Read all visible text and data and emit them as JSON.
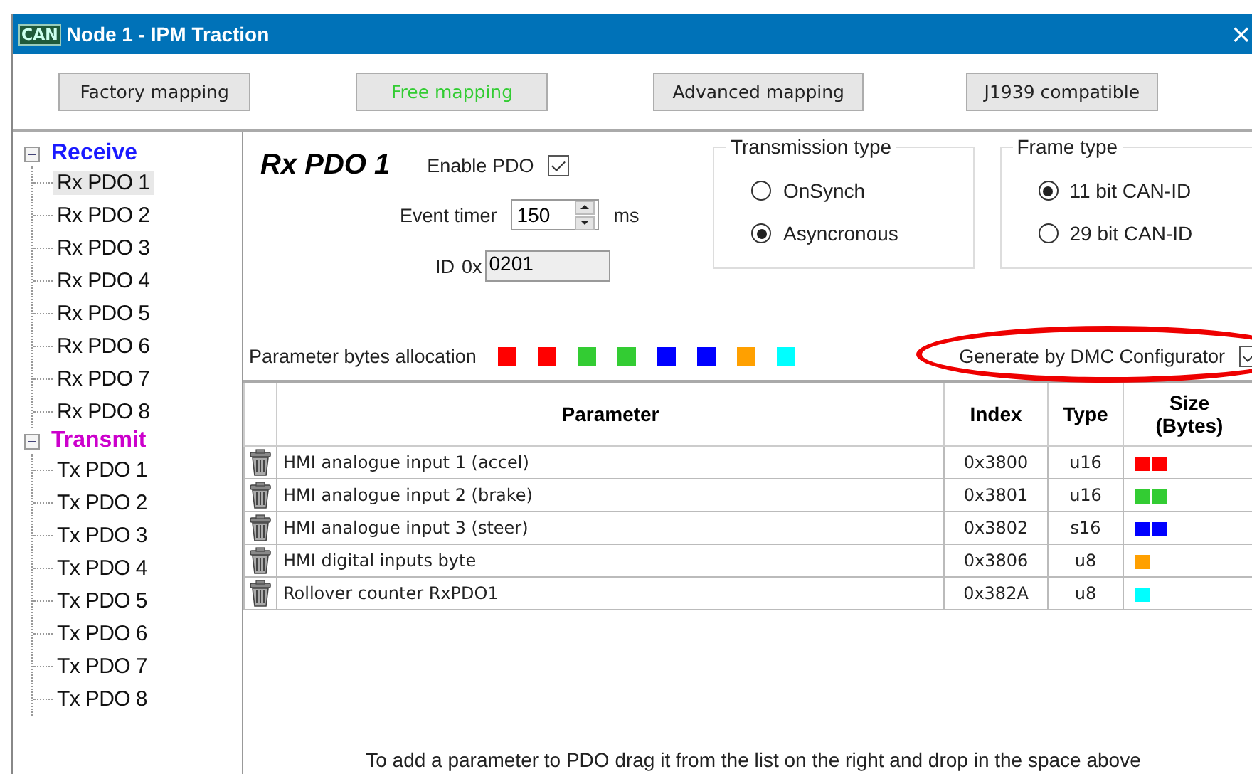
{
  "window": {
    "title": "Node 1 - IPM Traction",
    "logo": "CAN",
    "close": "×"
  },
  "mapping_buttons": [
    {
      "label": "Factory mapping",
      "selected": false
    },
    {
      "label": "Free mapping",
      "selected": true
    },
    {
      "label": "Advanced mapping",
      "selected": false
    },
    {
      "label": "J1939 compatible",
      "selected": false
    }
  ],
  "tree": [
    {
      "label": "Receive",
      "color": "#1a1aff",
      "expanded": true,
      "children": [
        {
          "label": "Rx PDO 1",
          "selected": true
        },
        {
          "label": "Rx PDO 2",
          "selected": false
        },
        {
          "label": "Rx PDO 3",
          "selected": false
        },
        {
          "label": "Rx PDO 4",
          "selected": false
        },
        {
          "label": "Rx PDO 5",
          "selected": false
        },
        {
          "label": "Rx PDO 6",
          "selected": false
        },
        {
          "label": "Rx PDO 7",
          "selected": false
        },
        {
          "label": "Rx PDO 8",
          "selected": false
        }
      ]
    },
    {
      "label": "Transmit",
      "color": "#cc00cc",
      "expanded": true,
      "children": [
        {
          "label": "Tx PDO 1",
          "selected": false
        },
        {
          "label": "Tx PDO 2",
          "selected": false
        },
        {
          "label": "Tx PDO 3",
          "selected": false
        },
        {
          "label": "Tx PDO 4",
          "selected": false
        },
        {
          "label": "Tx PDO 5",
          "selected": false
        },
        {
          "label": "Tx PDO 6",
          "selected": false
        },
        {
          "label": "Tx PDO 7",
          "selected": false
        },
        {
          "label": "Tx PDO 8",
          "selected": false
        }
      ]
    }
  ],
  "pdo": {
    "title": "Rx PDO 1",
    "enable_label": "Enable PDO",
    "enabled": true,
    "event_timer": {
      "label": "Event timer",
      "value": "150",
      "unit": "ms"
    },
    "id": {
      "label": "ID",
      "prefix": "0x",
      "value": "0201"
    },
    "transmission_type": {
      "title": "Transmission type",
      "options": [
        {
          "label": "OnSynch",
          "selected": false
        },
        {
          "label": "Asyncronous",
          "selected": true
        }
      ]
    },
    "frame_type": {
      "title": "Frame type",
      "options": [
        {
          "label": "11 bit CAN-ID",
          "selected": true
        },
        {
          "label": "29 bit CAN-ID",
          "selected": false
        }
      ]
    },
    "allocation": {
      "label": "Parameter bytes allocation",
      "bytes": [
        {
          "color": "#ff0000"
        },
        {
          "color": "#ff0000"
        },
        {
          "color": "#33cc33"
        },
        {
          "color": "#33cc33"
        },
        {
          "color": "#0000ff"
        },
        {
          "color": "#0000ff"
        },
        {
          "color": "#ffa000"
        },
        {
          "color": "#00ffff"
        }
      ]
    },
    "generate": {
      "label": "Generate by DMC Configurator",
      "checked": true,
      "highlighted": true
    }
  },
  "table": {
    "columns": [
      "Parameter",
      "Index",
      "Type",
      "Size\n(Bytes)"
    ],
    "rows": [
      {
        "parameter": "HMI analogue input 1 (accel)",
        "index": "0x3800",
        "type": "u16",
        "size": [
          {
            "color": "#ff0000"
          },
          {
            "color": "#ff0000"
          }
        ]
      },
      {
        "parameter": "HMI analogue input 2 (brake)",
        "index": "0x3801",
        "type": "u16",
        "size": [
          {
            "color": "#33cc33"
          },
          {
            "color": "#33cc33"
          }
        ]
      },
      {
        "parameter": "HMI analogue input 3 (steer)",
        "index": "0x3802",
        "type": "s16",
        "size": [
          {
            "color": "#0000ff"
          },
          {
            "color": "#0000ff"
          }
        ]
      },
      {
        "parameter": "HMI digital inputs byte",
        "index": "0x3806",
        "type": "u8",
        "size": [
          {
            "color": "#ffa000"
          }
        ]
      },
      {
        "parameter": "Rollover counter RxPDO1",
        "index": "0x382A",
        "type": "u8",
        "size": [
          {
            "color": "#00ffff"
          }
        ]
      }
    ]
  },
  "hint": "To add a parameter to PDO drag it from the list on the right and drop in the space above"
}
